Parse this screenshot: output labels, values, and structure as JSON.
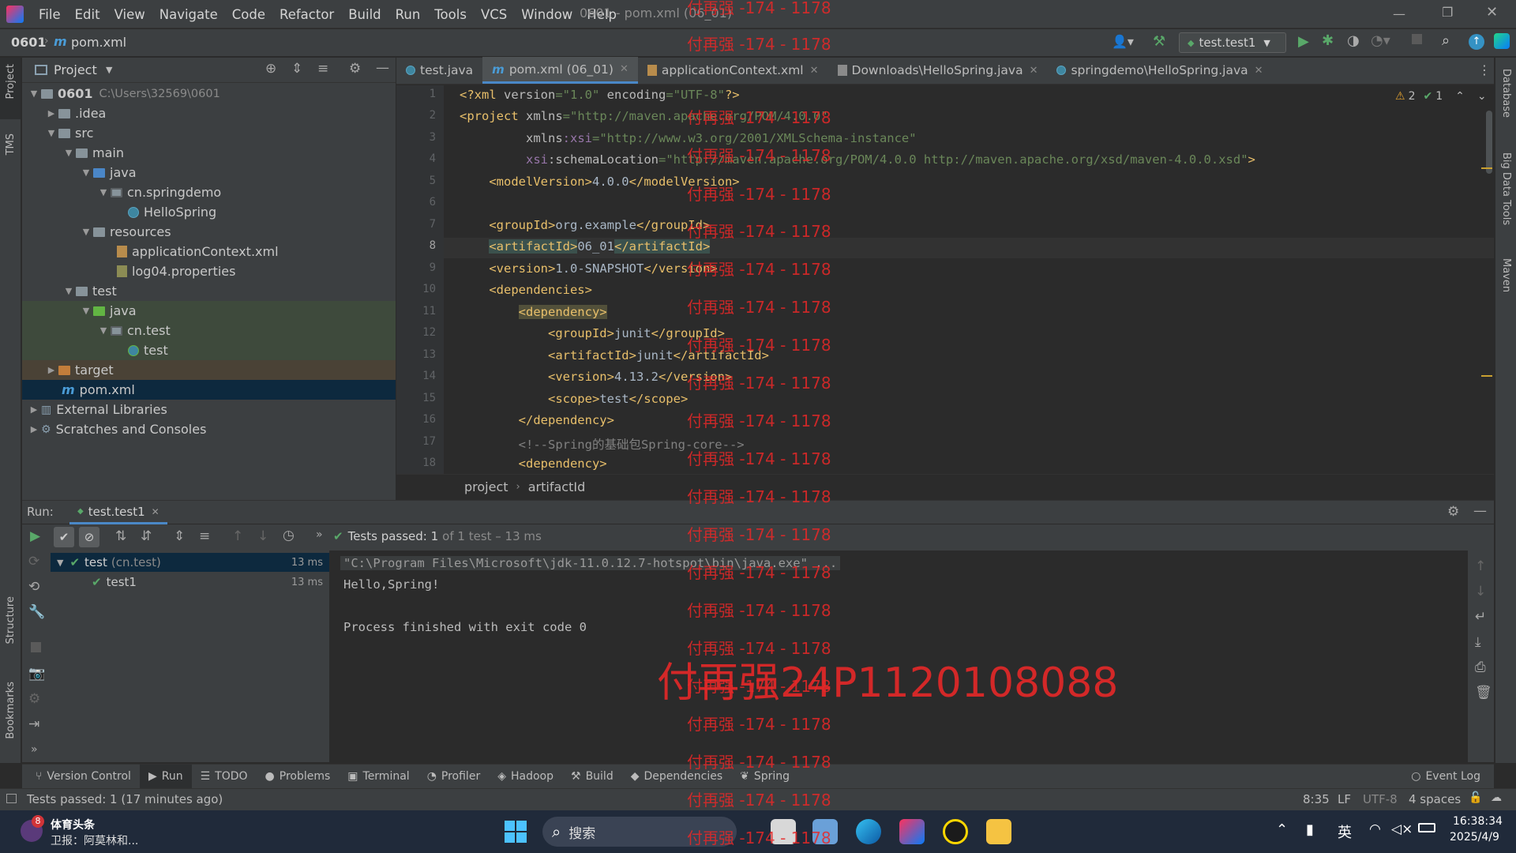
{
  "menu": [
    "File",
    "Edit",
    "View",
    "Navigate",
    "Code",
    "Refactor",
    "Build",
    "Run",
    "Tools",
    "VCS",
    "Window",
    "Help"
  ],
  "window_title": "0601 - pom.xml (06_01)",
  "nav": {
    "project": "0601",
    "file": "pom.xml",
    "run_config": "test.test1"
  },
  "left_strip": {
    "project": "Project",
    "tms": "TMS",
    "structure": "Structure",
    "bookmarks": "Bookmarks"
  },
  "right_strip": {
    "database": "Database",
    "bigdata": "Big Data Tools",
    "maven": "Maven"
  },
  "project_panel": {
    "title": "Project",
    "tree": [
      {
        "label": "0601",
        "extra": "C:\\Users\\32569\\0601"
      },
      {
        "label": ".idea"
      },
      {
        "label": "src"
      },
      {
        "label": "main"
      },
      {
        "label": "java"
      },
      {
        "label": "cn.springdemo"
      },
      {
        "label": "HelloSpring"
      },
      {
        "label": "resources"
      },
      {
        "label": "applicationContext.xml"
      },
      {
        "label": "log04.properties"
      },
      {
        "label": "test"
      },
      {
        "label": "java"
      },
      {
        "label": "cn.test"
      },
      {
        "label": "test"
      },
      {
        "label": "target"
      },
      {
        "label": "pom.xml"
      },
      {
        "label": "External Libraries"
      },
      {
        "label": "Scratches and Consoles"
      }
    ]
  },
  "editor_tabs": [
    "test.java",
    "pom.xml (06_01)",
    "applicationContext.xml",
    "Downloads\\HelloSpring.java",
    "springdemo\\HelloSpring.java"
  ],
  "inspections": {
    "warnings": "2",
    "ok": "1"
  },
  "line_numbers": [
    "1",
    "2",
    "3",
    "4",
    "5",
    "6",
    "7",
    "8",
    "9",
    "10",
    "11",
    "12",
    "13",
    "14",
    "15",
    "16",
    "17",
    "18"
  ],
  "breadcrumb": [
    "project",
    "artifactId"
  ],
  "run": {
    "label": "Run:",
    "tab": "test.test1",
    "tests_passed_bold": "Tests passed: 1",
    "tests_passed_rest": "of 1 test – 13 ms",
    "tree": [
      {
        "name": "test",
        "pkg": "(cn.test)",
        "time": "13 ms"
      },
      {
        "name": "test1",
        "time": "13 ms"
      }
    ],
    "console": [
      "\"C:\\Program Files\\Microsoft\\jdk-11.0.12.7-hotspot\\bin\\java.exe\" ...",
      "Hello,Spring!",
      "",
      "Process finished with exit code 0"
    ]
  },
  "bottom_tabs": [
    "Version Control",
    "Run",
    "TODO",
    "Problems",
    "Terminal",
    "Profiler",
    "Hadoop",
    "Build",
    "Dependencies",
    "Spring"
  ],
  "event_log": "Event Log",
  "status": {
    "message": "Tests passed: 1 (17 minutes ago)",
    "position": "8:35",
    "line_sep": "LF",
    "encoding": "UTF-8",
    "indent": "4 spaces"
  },
  "taskbar": {
    "news_badge": "8",
    "news_title": "体育头条",
    "news_sub": "卫报：阿莫林和...",
    "search": "搜索",
    "ime": "英",
    "time": "16:38:34",
    "date": "2025/4/9"
  },
  "watermark": {
    "small": "付再强 -174 - 1178",
    "big": "付再强24P1120108088"
  },
  "colors": {
    "accent": "#4a88c7",
    "tag": "#e8bf6a",
    "value": "#6a8759",
    "green": "#59a869",
    "watermark": "#e62828"
  }
}
